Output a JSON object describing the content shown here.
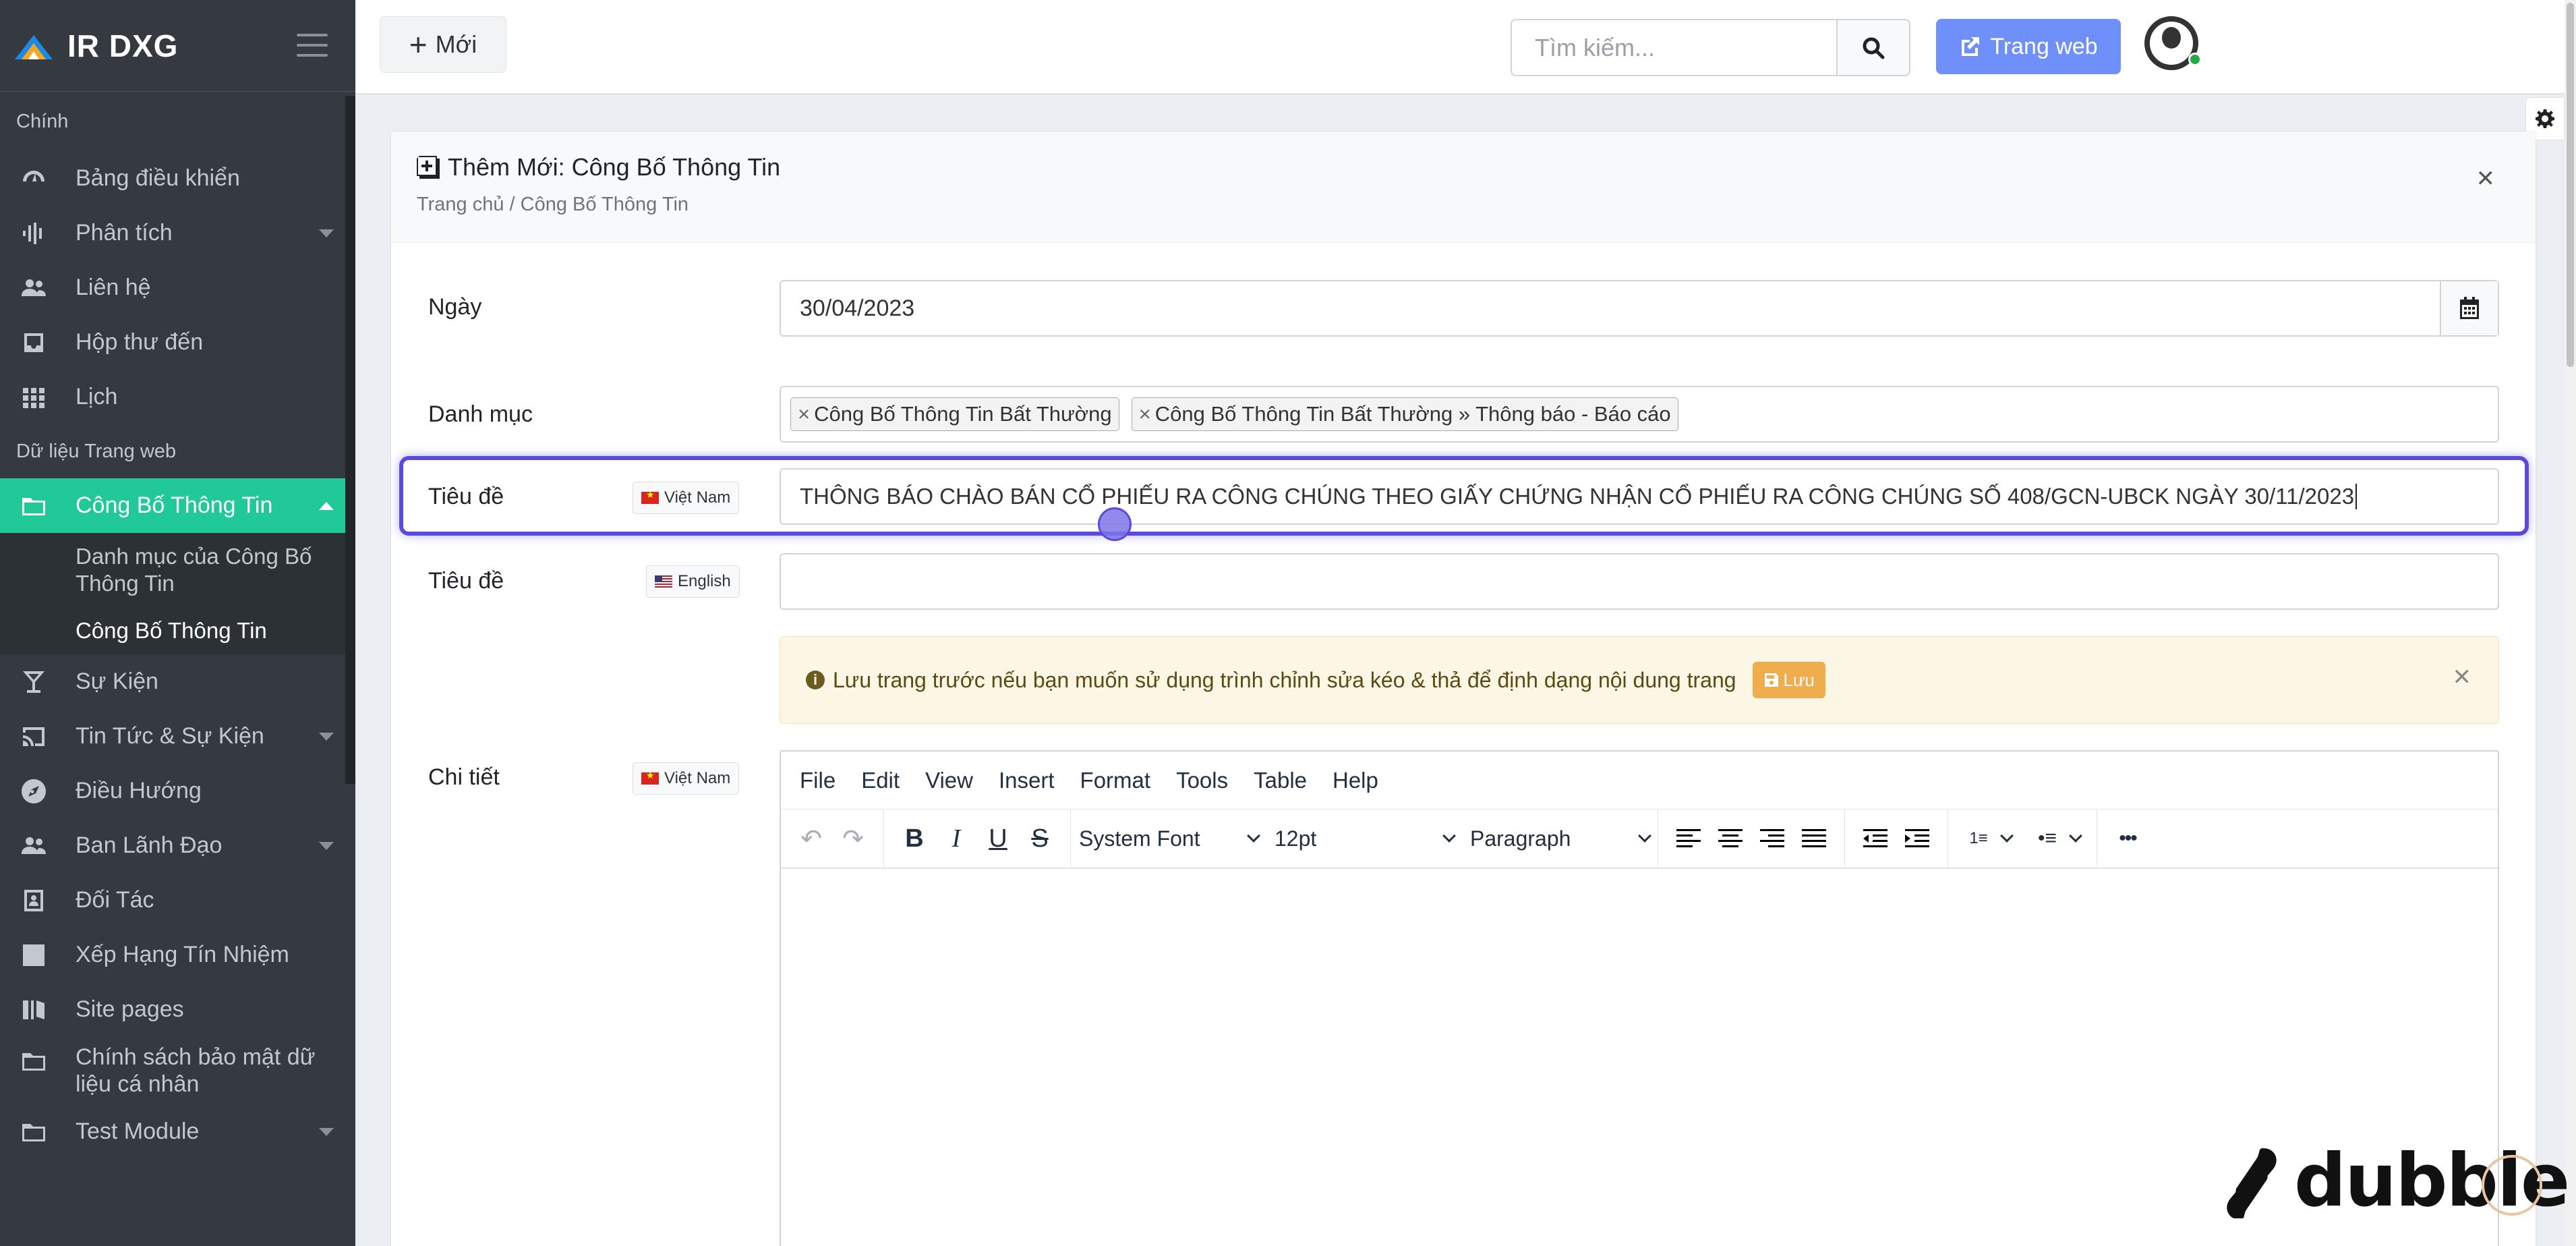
{
  "app": {
    "brand": "IR DXG"
  },
  "sidebar": {
    "section_main": "Chính",
    "main_items": [
      {
        "label": "Bảng điều khiển"
      },
      {
        "label": "Phân tích"
      },
      {
        "label": "Liên hệ"
      },
      {
        "label": "Hộp thư đến"
      },
      {
        "label": "Lịch"
      }
    ],
    "section_web": "Dữ liệu Trang web",
    "active_item": "Công Bố Thông Tin",
    "sub_items": [
      {
        "label": "Danh mục của Công Bố Thông Tin"
      },
      {
        "label": "Công Bố Thông Tin"
      }
    ],
    "web_items": [
      {
        "label": "Sự Kiện"
      },
      {
        "label": "Tin Tức & Sự Kiện"
      },
      {
        "label": "Điều Hướng"
      },
      {
        "label": "Ban Lãnh Đạo"
      },
      {
        "label": "Đối Tác"
      },
      {
        "label": "Xếp Hạng Tín Nhiệm"
      },
      {
        "label": "Site pages"
      },
      {
        "label": "Chính sách bảo mật dữ liệu cá nhân"
      },
      {
        "label": "Test Module"
      }
    ]
  },
  "topbar": {
    "new_label": "Mới",
    "search_placeholder": "Tìm kiếm...",
    "website_label": "Trang web"
  },
  "page": {
    "title": "Thêm Mới: Công Bố Thông Tin",
    "breadcrumb": "Trang chủ / Công Bố Thông Tin"
  },
  "form": {
    "date_label": "Ngày",
    "date_value": "30/04/2023",
    "category_label": "Danh mục",
    "category_tags": [
      "Công Bố Thông Tin Bất Thường",
      "Công Bố Thông Tin Bất Thường » Thông báo - Báo cáo"
    ],
    "title_label": "Tiêu đề",
    "lang_vi": "Việt Nam",
    "lang_en": "English",
    "title_vi_value": "THÔNG BÁO CHÀO BÁN CỔ PHIẾU RA CÔNG CHÚNG THEO GIẤY CHỨNG NHẬN CỔ PHIẾU RA CÔNG CHÚNG SỐ 408/GCN-UBCK NGÀY 30/11/2023",
    "title_en_value": "",
    "alert_text": "Lưu trang trước nếu bạn muốn sử dụng trình chỉnh sửa kéo & thả để định dạng nội dung trang",
    "alert_save": "Lưu",
    "detail_label": "Chi tiết"
  },
  "editor": {
    "menus": [
      "File",
      "Edit",
      "View",
      "Insert",
      "Format",
      "Tools",
      "Table",
      "Help"
    ],
    "font": "System Font",
    "size": "12pt",
    "block": "Paragraph"
  },
  "watermark": "dubble",
  "colors": {
    "sidebar": "#343a40",
    "active": "#20c997",
    "primary": "#6f8ffa",
    "focus": "#5b4bdc"
  }
}
